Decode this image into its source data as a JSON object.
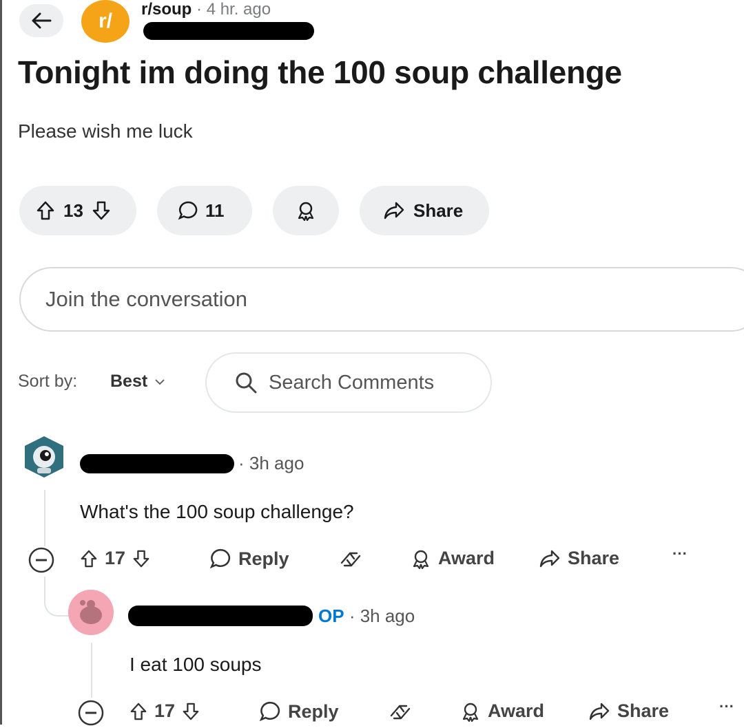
{
  "header": {
    "subreddit": "r/soup",
    "subreddit_icon_text": "r/",
    "separator": "·",
    "post_age": "4 hr. ago"
  },
  "post": {
    "title": "Tonight im doing the 100 soup challenge",
    "body": "Please wish me luck",
    "upvotes": "13",
    "comments": "11",
    "share_label": "Share"
  },
  "composer": {
    "placeholder": "Join the conversation"
  },
  "sort": {
    "label": "Sort by:",
    "value": "Best",
    "search_placeholder": "Search Comments"
  },
  "comments": [
    {
      "time": "3h ago",
      "text": "What's the 100 soup challenge?",
      "score": "17",
      "reply_label": "Reply",
      "award_label": "Award",
      "share_label": "Share",
      "more_label": "···"
    },
    {
      "op_badge": "OP",
      "time": "3h ago",
      "text": "I eat 100 soups",
      "score": "17",
      "reply_label": "Reply",
      "award_label": "Award",
      "share_label": "Share",
      "more_label": "···"
    }
  ],
  "colors": {
    "subreddit_icon": "#f5a417",
    "op_badge": "#0079d3",
    "pill_bg": "#edeff1"
  }
}
